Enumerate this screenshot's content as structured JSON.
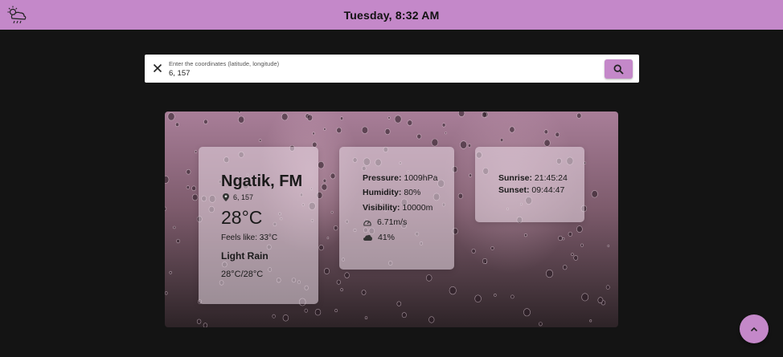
{
  "header": {
    "title": "Tuesday, 8:32 AM",
    "logo_icon": "rainy-cloud-sun-icon"
  },
  "search": {
    "label": "Enter the coordinates (latitude, longitude)",
    "value": "6, 157",
    "clear_icon": "close-icon",
    "button_icon": "search-icon"
  },
  "weather": {
    "city": "Ngatik, FM",
    "coords": "6, 157",
    "temperature": "28°C",
    "feels_like": "Feels like: 33°C",
    "description": "Light Rain",
    "range": "28°C/28°C"
  },
  "details": {
    "pressure_label": "Pressure:",
    "pressure_value": " 1009hPa",
    "humidity_label": "Humidity:",
    "humidity_value": " 80%",
    "visibility_label": "Visibility:",
    "visibility_value": " 10000m",
    "wind": "6.71m/s",
    "clouds": "41%"
  },
  "sun": {
    "sunrise_label": "Sunrise:",
    "sunrise_value": " 21:45:24",
    "sunset_label": "Sunset:",
    "sunset_value": " 09:44:47"
  },
  "colors": {
    "accent": "#c488c9",
    "background": "#141414"
  },
  "fab": {
    "icon": "chevron-up-icon"
  }
}
